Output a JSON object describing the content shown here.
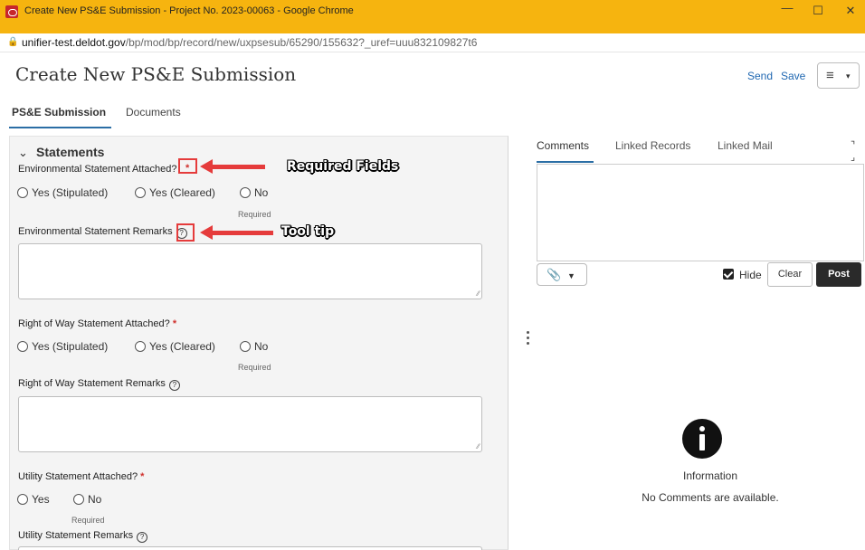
{
  "window": {
    "title": "Create New PS&E Submission - Project No. 2023-00063 - Google Chrome",
    "minimize": "—",
    "maximize": "☐",
    "close": "✕"
  },
  "browser": {
    "url_host": "unifier-test.deldot.gov",
    "url_path": "/bp/mod/bp/record/new/uxpsesub/65290/155632?_uref=uuu832109827t6"
  },
  "header": {
    "title": "Create New PS&E Submission",
    "send_label": "Send",
    "save_label": "Save",
    "menu_icon": "≡",
    "menu_caret": "▾"
  },
  "tabs": [
    {
      "label": "PS&E Submission",
      "active": true
    },
    {
      "label": "Documents",
      "active": false
    }
  ],
  "form": {
    "section_title": "Statements",
    "section_chevron": "⌄",
    "required_star": "*",
    "help_glyph": "?",
    "fields": [
      {
        "label": "Environmental Statement Attached?",
        "options": [
          "Yes (Stipulated)",
          "Yes (Cleared)",
          "No"
        ],
        "required_note": "Required"
      },
      {
        "label": "Environmental Statement Remarks"
      },
      {
        "label": "Right of Way Statement Attached?",
        "options": [
          "Yes (Stipulated)",
          "Yes (Cleared)",
          "No"
        ],
        "required_note": "Required"
      },
      {
        "label": "Right of Way Statement Remarks"
      },
      {
        "label": "Utility Statement Attached?",
        "options": [
          "Yes",
          "No"
        ],
        "required_note": "Required"
      },
      {
        "label": "Utility Statement Remarks"
      }
    ]
  },
  "annotations": {
    "required_fields": "Required Fields",
    "tool_tip": "Tool tip",
    "color": "#e53b3b"
  },
  "comments_panel": {
    "tabs": [
      "Comments",
      "Linked Records",
      "Linked Mail"
    ],
    "hide_label": "Hide",
    "hide_checked": true,
    "clear_label": "Clear",
    "post_label": "Post",
    "empty_title": "Information",
    "empty_message": "No Comments are available."
  },
  "colors": {
    "titlebar": "#f6b40f",
    "link": "#1f67b1",
    "accent": "#2b6ea5",
    "required": "#d0312d"
  }
}
